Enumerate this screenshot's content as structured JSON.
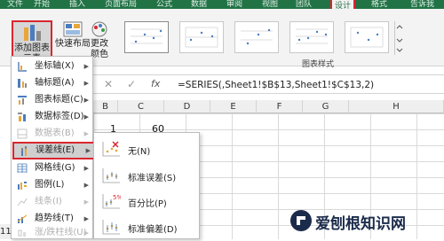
{
  "ribbon": {
    "tabs": [
      {
        "label": "文件",
        "active": false
      },
      {
        "label": "开始",
        "active": false
      },
      {
        "label": "插入",
        "active": false
      },
      {
        "label": "页面布局",
        "active": false
      },
      {
        "label": "公式",
        "active": false
      },
      {
        "label": "数据",
        "active": false
      },
      {
        "label": "审阅",
        "active": false
      },
      {
        "label": "视图",
        "active": false
      },
      {
        "label": "团队",
        "active": false
      },
      {
        "label": "设计",
        "active": true
      },
      {
        "label": "格式",
        "active": false
      },
      {
        "label": "告诉我",
        "active": false
      }
    ],
    "add_element_label_1": "添加图表",
    "add_element_label_2": "元素",
    "quick_layout_label": "快速布局",
    "change_colors_label_1": "更改",
    "change_colors_label_2": "颜色",
    "chart_styles_group": "图表样式",
    "accent_color": "#217346"
  },
  "formula_bar": {
    "cancel_glyph": "✕",
    "enter_glyph": "✓",
    "fx_label": "fx",
    "formula": "=SERIES(,Sheet1!$B$13,Sheet1!$C$13,2)"
  },
  "columns": [
    "B",
    "C",
    "D",
    "E",
    "F",
    "G",
    "H"
  ],
  "cells": {
    "b_value": "1",
    "c_value": "60"
  },
  "row_number": "11",
  "menu": {
    "items": [
      {
        "label": "坐标轴(X)",
        "icon": "axes-icon",
        "disabled": false,
        "highlight": false
      },
      {
        "label": "轴标题(A)",
        "icon": "axis-title-icon",
        "disabled": false,
        "highlight": false
      },
      {
        "label": "图表标题(C)",
        "icon": "chart-title-icon",
        "disabled": false,
        "highlight": false
      },
      {
        "label": "数据标签(D)",
        "icon": "data-labels-icon",
        "disabled": false,
        "highlight": false
      },
      {
        "label": "数据表(B)",
        "icon": "data-table-icon",
        "disabled": true,
        "highlight": false
      },
      {
        "label": "误差线(E)",
        "icon": "error-bars-icon",
        "disabled": false,
        "highlight": true
      },
      {
        "label": "网格线(G)",
        "icon": "gridlines-icon",
        "disabled": false,
        "highlight": false
      },
      {
        "label": "图例(L)",
        "icon": "legend-icon",
        "disabled": false,
        "highlight": false
      },
      {
        "label": "线条(I)",
        "icon": "lines-icon",
        "disabled": true,
        "highlight": false
      },
      {
        "label": "趋势线(T)",
        "icon": "trendline-icon",
        "disabled": false,
        "highlight": false
      },
      {
        "label": "涨/跌柱线(U)",
        "icon": "up-down-bars-icon",
        "disabled": true,
        "highlight": false
      }
    ]
  },
  "submenu": {
    "items": [
      {
        "label": "无(N)",
        "icon": "no-error-bars-icon"
      },
      {
        "label": "标准误差(S)",
        "icon": "standard-error-icon"
      },
      {
        "label": "百分比(P)",
        "icon": "percentage-icon"
      },
      {
        "label": "标准偏差(D)",
        "icon": "standard-deviation-icon"
      }
    ],
    "percent_glyph": "5%"
  },
  "watermark": {
    "text": "爱刨根知识网"
  }
}
